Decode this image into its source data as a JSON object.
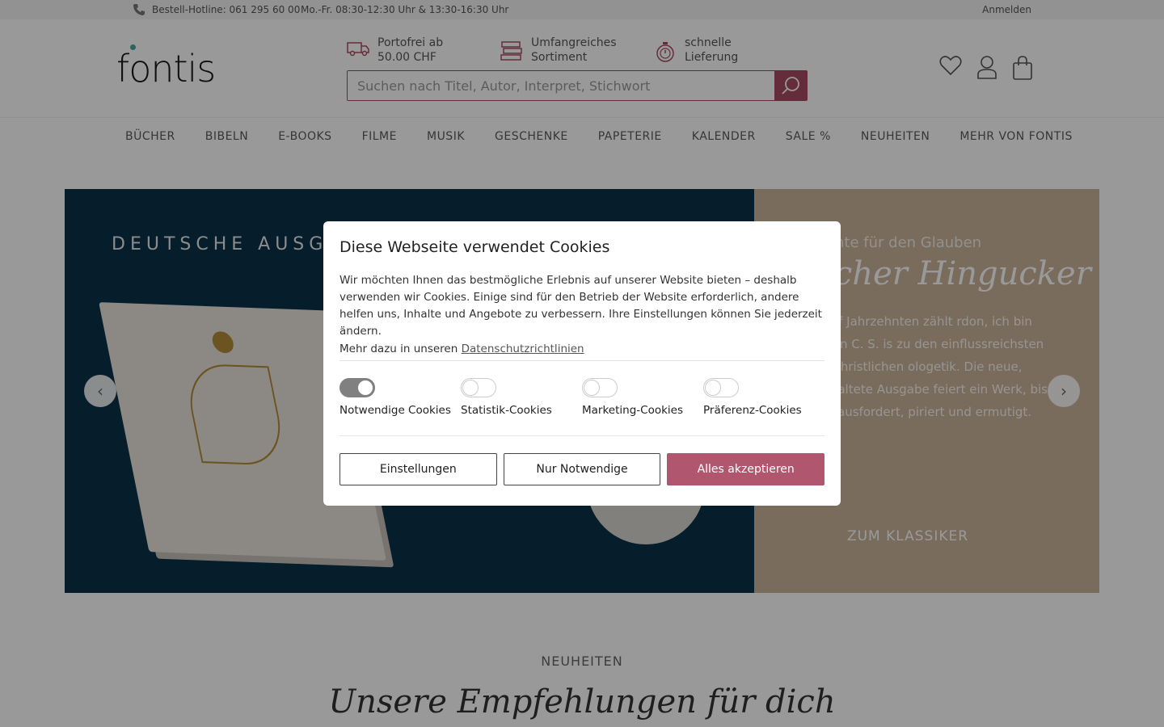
{
  "topbar": {
    "hotline": "Bestell-Hotline: 061 295 60 00",
    "hours": "Mo.-Fr. 08:30-12:30 Uhr & 13:30-16:30 Uhr",
    "login": "Anmelden"
  },
  "header": {
    "logo": "fontis",
    "usps": [
      {
        "line1": "Portofrei ab",
        "line2": "50.00 CHF",
        "icon": "truck-icon"
      },
      {
        "line1": "Umfangreiches",
        "line2": "Sortiment",
        "icon": "books-icon"
      },
      {
        "line1": "schnelle",
        "line2": "Lieferung",
        "icon": "stopwatch-icon"
      }
    ],
    "search_placeholder": "Suchen nach Titel, Autor, Interpret, Stichwort"
  },
  "nav": {
    "items": [
      "BÜCHER",
      "BIBELN",
      "E-BOOKS",
      "FILME",
      "MUSIK",
      "GESCHENKE",
      "PAPETERIE",
      "KALENDER",
      "SALE %",
      "NEUHEITEN",
      "MEHR VON FONTIS"
    ]
  },
  "hero": {
    "tag": "DEUTSCHE AUSGA",
    "right_sub": "umente für den Glauben",
    "right_head": "ibscher Hingucker",
    "right_body": "t über fünf Jahrzehnten zählt rdon, ich bin Christ» von C. S. is zu den einflussreichsten hern der christlichen ologetik. Die neue, liebevoll taltete Ausgabe feiert ein Werk, bis heute herausfordert, piriert und ermutigt.",
    "cta": "ZUM KLASSIKER"
  },
  "section": {
    "label": "NEUHEITEN",
    "head": "Unsere Empfehlungen für dich"
  },
  "cookie": {
    "title": "Diese Webseite verwendet Cookies",
    "text": "Wir möchten Ihnen das bestmögliche Erlebnis auf unserer Website bieten – deshalb verwenden wir Cookies. Einige sind für den Betrieb der Website erforderlich, andere helfen uns, Inhalte und Angebote zu verbessern. Ihre Einstellungen können Sie jederzeit ändern.",
    "more_prefix": "Mehr dazu in unseren",
    "more_link": "Datenschutzrichtlinien",
    "toggles": [
      {
        "label": "Notwendige Cookies",
        "on": true
      },
      {
        "label": "Statistik-Cookies",
        "on": false
      },
      {
        "label": "Marketing-Cookies",
        "on": false
      },
      {
        "label": "Präferenz-Cookies",
        "on": false
      }
    ],
    "btn_settings": "Einstellungen",
    "btn_necessary": "Nur Notwendige",
    "btn_accept": "Alles akzeptieren"
  },
  "colors": {
    "brand": "#a94b63",
    "accept": "#b0576f",
    "hero_dark": "#0a3248",
    "hero_tan": "#ccb59c"
  }
}
